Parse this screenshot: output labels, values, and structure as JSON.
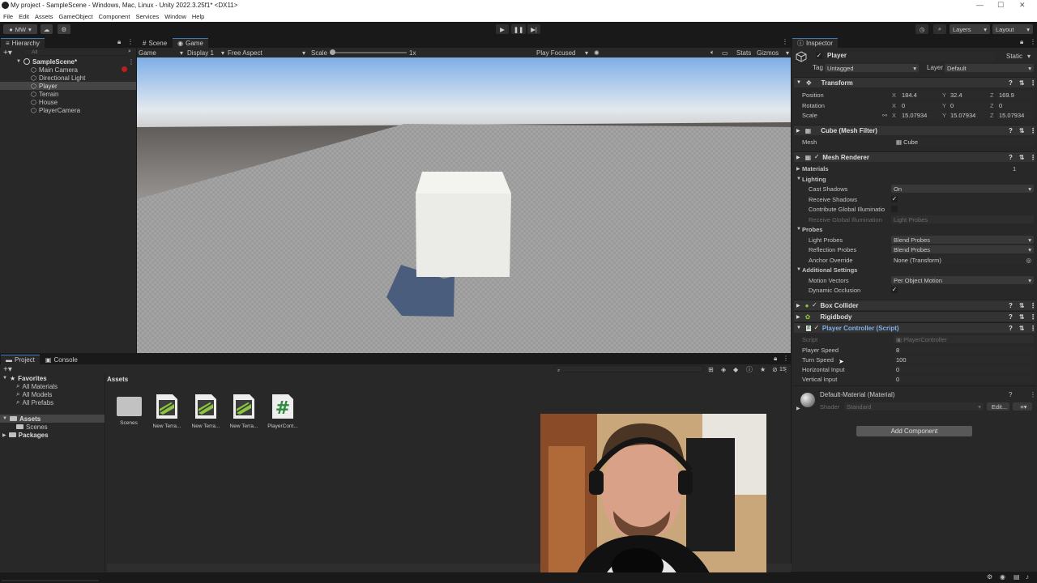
{
  "window": {
    "title": "My project - SampleScene - Windows, Mac, Linux - Unity 2022.3.25f1* <DX11>"
  },
  "menu": [
    "File",
    "Edit",
    "Assets",
    "GameObject",
    "Component",
    "Services",
    "Window",
    "Help"
  ],
  "toolbar": {
    "account": "MW",
    "layers": "Layers",
    "layout": "Layout"
  },
  "hierarchy": {
    "tab": "Hierarchy",
    "search_placeholder": "All",
    "scene": "SampleScene*",
    "items": [
      "Main Camera",
      "Directional Light",
      "Player",
      "Terrain",
      "House",
      "PlayerCamera"
    ]
  },
  "scene_view": {
    "tabs": [
      "Scene",
      "Game"
    ],
    "game_label": "Game",
    "display": "Display 1",
    "aspect": "Free Aspect",
    "scale_label": "Scale",
    "scale_value": "1x",
    "play_mode": "Play Focused",
    "stats": "Stats",
    "gizmos": "Gizmos"
  },
  "project": {
    "tabs": [
      "Project",
      "Console"
    ],
    "favorites_label": "Favorites",
    "favorites": [
      "All Materials",
      "All Models",
      "All Prefabs"
    ],
    "assets_label": "Assets",
    "assets_children": [
      "Scenes"
    ],
    "packages_label": "Packages",
    "breadcrumb": "Assets",
    "hidden_count": "15",
    "assets": [
      {
        "name": "Scenes",
        "kind": "folder"
      },
      {
        "name": "New Terra...",
        "kind": "terrain"
      },
      {
        "name": "New Terra...",
        "kind": "terrain"
      },
      {
        "name": "New Terra...",
        "kind": "terrain"
      },
      {
        "name": "PlayerCont...",
        "kind": "script"
      }
    ]
  },
  "inspector": {
    "tab": "Inspector",
    "object_name": "Player",
    "static_label": "Static",
    "tag_label": "Tag",
    "tag_value": "Untagged",
    "layer_label": "Layer",
    "layer_value": "Default",
    "transform": {
      "title": "Transform",
      "position_label": "Position",
      "rotation_label": "Rotation",
      "scale_label": "Scale",
      "position": {
        "x": "184.4",
        "y": "32.4",
        "z": "169.9"
      },
      "rotation": {
        "x": "0",
        "y": "0",
        "z": "0"
      },
      "scale": {
        "x": "15.07934",
        "y": "15.07934",
        "z": "15.07934"
      }
    },
    "mesh_filter": {
      "title": "Cube (Mesh Filter)",
      "mesh_label": "Mesh",
      "mesh_value": "Cube"
    },
    "mesh_renderer": {
      "title": "Mesh Renderer",
      "materials_label": "Materials",
      "materials_count": "1",
      "lighting_label": "Lighting",
      "cast_shadows_label": "Cast Shadows",
      "cast_shadows_value": "On",
      "receive_shadows_label": "Receive Shadows",
      "contribute_gi_label": "Contribute Global Illuminatio",
      "receive_gi_label": "Receive Global Illumination",
      "receive_gi_value": "Light Probes",
      "probes_label": "Probes",
      "light_probes_label": "Light Probes",
      "light_probes_value": "Blend Probes",
      "reflection_probes_label": "Reflection Probes",
      "reflection_probes_value": "Blend Probes",
      "anchor_override_label": "Anchor Override",
      "anchor_override_value": "None (Transform)",
      "additional_label": "Additional Settings",
      "motion_vectors_label": "Motion Vectors",
      "motion_vectors_value": "Per Object Motion",
      "dynamic_occlusion_label": "Dynamic Occlusion"
    },
    "box_collider": "Box Collider",
    "rigidbody": "Rigidbody",
    "player_controller": {
      "title": "Player Controller (Script)",
      "script_label": "Script",
      "script_value": "PlayerController",
      "player_speed_label": "Player Speed",
      "player_speed": "8",
      "turn_speed_label": "Turn Speed",
      "turn_speed": "100",
      "horizontal_label": "Horizontal Input",
      "horizontal": "0",
      "vertical_label": "Vertical Input",
      "vertical": "0"
    },
    "material": {
      "title": "Default-Material (Material)",
      "shader_label": "Shader",
      "shader_value": "Standard",
      "edit_label": "Edit..."
    },
    "add_component": "Add Component"
  },
  "colors": {
    "accent": "#3a79bb",
    "panel": "#282828",
    "dark": "#191919",
    "selection": "#2c5d87",
    "sky_top": "#7eaee6",
    "ground": "#9d9d9d"
  }
}
